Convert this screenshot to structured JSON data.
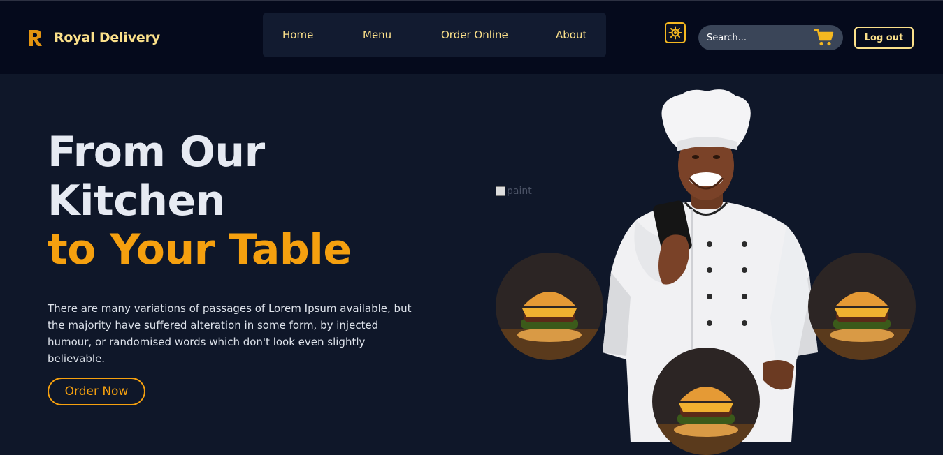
{
  "brand": {
    "name": "Royal Delivery",
    "logo_letter": "R",
    "logo_icon": "brand-r-logo"
  },
  "nav": {
    "items": [
      {
        "label": "Home"
      },
      {
        "label": "Menu"
      },
      {
        "label": "Order Online"
      },
      {
        "label": "About"
      }
    ]
  },
  "header": {
    "theme_icon": "sun-icon",
    "search": {
      "placeholder": "Search..."
    },
    "cart_icon": "shopping-cart-icon",
    "logout_label": "Log out"
  },
  "hero": {
    "title_line1": "From Our",
    "title_line2": "Kitchen",
    "title_accent": "to Your Table",
    "description": "There are many variations of passages of Lorem Ipsum available, but the majority have suffered alteration in some form, by injected humour, or randomised words which don't look even slightly believable.",
    "cta_label": "Order Now",
    "image_alt": "paint"
  },
  "colors": {
    "page_bg": "#0f1729",
    "header_bg": "#050a1c",
    "nav_bg": "#121b30",
    "accent": "#f5a00f",
    "nav_text": "#fbe08a",
    "search_bg": "#3a4558"
  }
}
